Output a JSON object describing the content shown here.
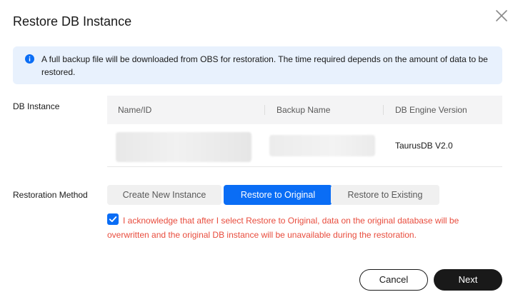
{
  "dialog": {
    "title": "Restore DB Instance",
    "close_icon": "close-icon"
  },
  "info": {
    "icon": "info-icon",
    "text": "A full backup file will be downloaded from OBS for restoration. The time required depends on the amount of data to be restored."
  },
  "db_instance": {
    "label": "DB Instance",
    "columns": [
      "Name/ID",
      "Backup Name",
      "DB Engine Version"
    ],
    "rows": [
      {
        "name_id": "",
        "backup_name": "",
        "engine_version": "TaurusDB V2.0"
      }
    ]
  },
  "restoration": {
    "label": "Restoration Method",
    "options": [
      "Create New Instance",
      "Restore to Original",
      "Restore to Existing"
    ],
    "selected": "Restore to Original"
  },
  "acknowledge": {
    "checked": true,
    "line1": "I acknowledge that after I select Restore to Original, data on the original database will be",
    "line2": "overwritten and the original DB instance will be unavailable during the restoration."
  },
  "footer": {
    "cancel_label": "Cancel",
    "next_label": "Next"
  },
  "colors": {
    "accent": "#0a6df5",
    "info_bg": "#e8f1fd",
    "warning_text": "#e84c3d",
    "primary_button": "#191919"
  }
}
